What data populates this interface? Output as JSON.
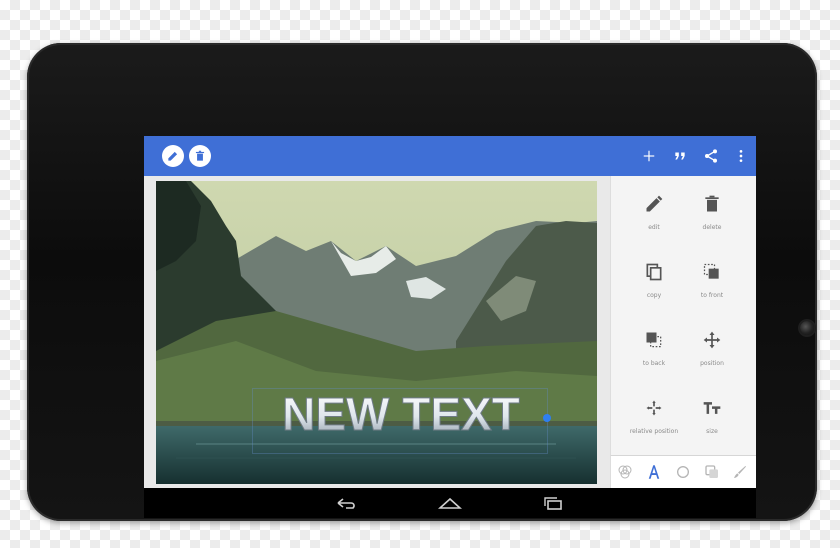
{
  "app": {
    "accent_color": "#3f6fd6",
    "appbar_left_icons": [
      "edit-circle-icon",
      "delete-circle-icon"
    ],
    "appbar_right_icons": [
      "add-icon",
      "quote-icon",
      "share-icon",
      "overflow-menu-icon"
    ]
  },
  "canvas": {
    "overlay_text": "NEW TEXT",
    "background_image": "mountain lake landscape"
  },
  "sidebar": {
    "tools": [
      {
        "icon": "pencil-icon",
        "label": "edit"
      },
      {
        "icon": "trash-icon",
        "label": "delete"
      },
      {
        "icon": "copy-icon",
        "label": "copy"
      },
      {
        "icon": "bring-to-front-icon",
        "label": "to front"
      },
      {
        "icon": "send-to-back-icon",
        "label": "to back"
      },
      {
        "icon": "move-arrows-icon",
        "label": "position"
      },
      {
        "icon": "relative-position-icon",
        "label": "relative position"
      },
      {
        "icon": "text-size-icon",
        "label": "size"
      }
    ],
    "bottom_tabs": [
      "color-palette-icon",
      "font-a-icon",
      "outline-circle-icon",
      "shadow-layers-icon",
      "brush-icon"
    ],
    "active_tab": "font-a-icon"
  },
  "navigation": {
    "buttons": [
      "back-icon",
      "home-icon",
      "recent-apps-icon"
    ]
  }
}
